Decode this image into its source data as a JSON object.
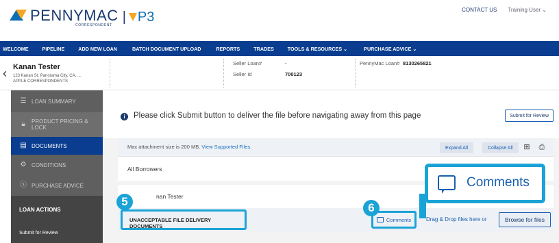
{
  "header": {
    "brand_name": "PENNYMAC",
    "brand_sub": "CORRESPONDENT",
    "brand_separator": "|",
    "product": "P3",
    "top_links": [
      "CONTACT US",
      "Training User ⌄"
    ]
  },
  "nav": {
    "items": [
      "WELCOME",
      "PIPELINE",
      "ADD NEW LOAN",
      "BATCH DOCUMENT UPLOAD",
      "REPORTS",
      "TRADES",
      "TOOLS & RESOURCES ⌄",
      "PURCHASE ADVICE ⌄"
    ]
  },
  "loan": {
    "borrower_name": "Kanan Tester",
    "address_line": "123 Kanan St, Panorama City, CA, ...",
    "company": "APPLE CORRESPONDENTS",
    "seller_loan_label": "Seller Loan#",
    "seller_loan_value": "-",
    "seller_id_label": "Seller Id",
    "seller_id_value": "700123",
    "pennymac_loan_label": "PennyMac Loan#",
    "pennymac_loan_value": "8130265821"
  },
  "sidebar": {
    "items": [
      {
        "label": "LOAN SUMMARY",
        "icon": "list-icon"
      },
      {
        "label": "PRODUCT PRICING &",
        "label2": "LOCK",
        "icon": "lock-icon"
      },
      {
        "label": "DOCUMENTS",
        "icon": "document-icon"
      },
      {
        "label": "CONDITIONS",
        "icon": "conditions-icon"
      },
      {
        "label": "PURCHASE ADVICE",
        "icon": "dollar-icon"
      }
    ],
    "section_title": "LOAN ACTIONS",
    "actions": [
      "Submit for Review"
    ]
  },
  "main": {
    "notice": "Please click Submit button to deliver the file before navigating away from this page",
    "submit_review_btn": "Submit for Review",
    "attach_text": "Max attachment size is 200 MB.",
    "attach_link": "View Supported Files.",
    "expand_all": "Expand All",
    "collapse_all": "Collapse All",
    "all_borrowers": "All Borrowers",
    "borrower_partial": "nan Tester",
    "doc_name": "UNACCEPTABLE FILE DELIVERY DOCUMENTS",
    "comments": "Comments",
    "drag_drop": "Drag & Drop files here or",
    "browse": "Browse for files"
  },
  "callout": {
    "label": "Comments"
  },
  "badges": {
    "step5": "5",
    "step6": "6"
  },
  "colors": {
    "nav_bg": "#0a3d8f",
    "highlight": "#1aa3d6",
    "sidebar_bg": "#5b5b5b",
    "link": "#1a5fb0"
  }
}
